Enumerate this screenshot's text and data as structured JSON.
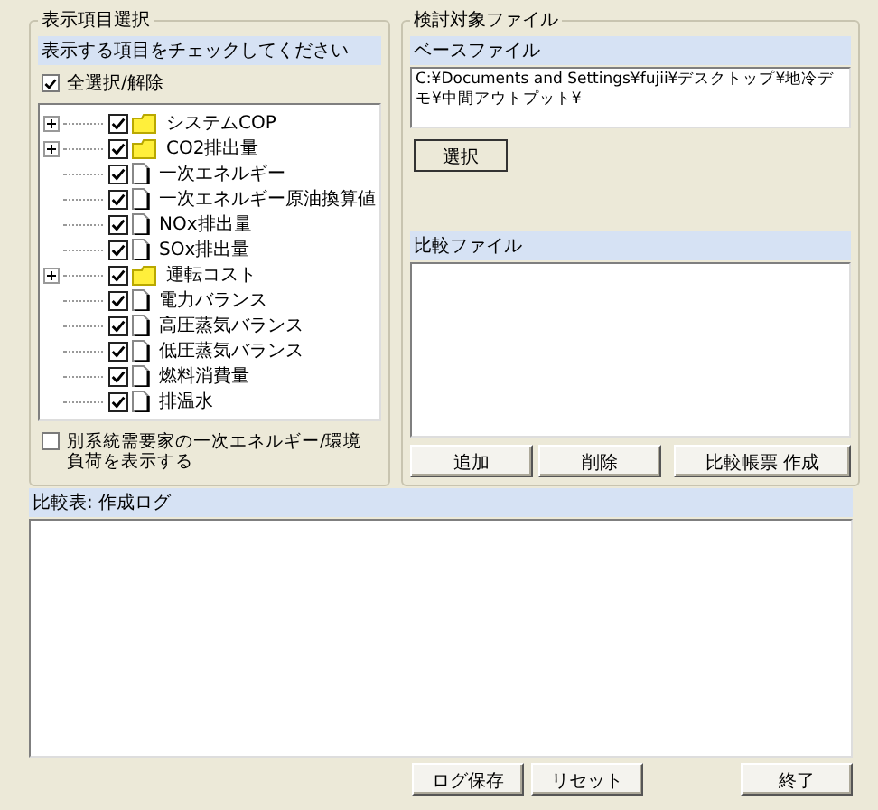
{
  "display_group": {
    "legend": "表示項目選択",
    "header": "表示する項目をチェックしてください",
    "select_all": {
      "label": "全選択/解除",
      "checked": true
    },
    "tree": [
      {
        "label": "システムCOP",
        "kind": "folder",
        "expanded": false,
        "checked": true
      },
      {
        "label": "CO2排出量",
        "kind": "folder",
        "expanded": false,
        "checked": true
      },
      {
        "label": "一次エネルギー",
        "kind": "doc",
        "checked": true
      },
      {
        "label": "一次エネルギー原油換算値",
        "kind": "doc",
        "checked": true
      },
      {
        "label": "NOx排出量",
        "kind": "doc",
        "checked": true
      },
      {
        "label": "SOx排出量",
        "kind": "doc",
        "checked": true
      },
      {
        "label": "運転コスト",
        "kind": "folder",
        "expanded": false,
        "checked": true
      },
      {
        "label": "電力バランス",
        "kind": "doc",
        "checked": true
      },
      {
        "label": "高圧蒸気バランス",
        "kind": "doc",
        "checked": true
      },
      {
        "label": "低圧蒸気バランス",
        "kind": "doc",
        "checked": true
      },
      {
        "label": "燃料消費量",
        "kind": "doc",
        "checked": true
      },
      {
        "label": "排温水",
        "kind": "doc",
        "checked": true
      }
    ],
    "option": {
      "label": "別系統需要家の一次エネルギー/環境負荷を表示する",
      "checked": false
    }
  },
  "file_group": {
    "legend": "検討対象ファイル",
    "base_header": "ベースファイル",
    "base_path": "C:¥Documents and Settings¥fujii¥デスクトップ¥地冷デモ¥中間アウトプット¥",
    "select_button": "選択",
    "compare_header": "比較ファイル",
    "buttons": [
      "追加",
      "削除",
      "比較帳票 作成"
    ]
  },
  "log": {
    "header": "比較表: 作成ログ"
  },
  "footer_buttons": [
    "ログ保存",
    "リセット",
    "終了"
  ]
}
